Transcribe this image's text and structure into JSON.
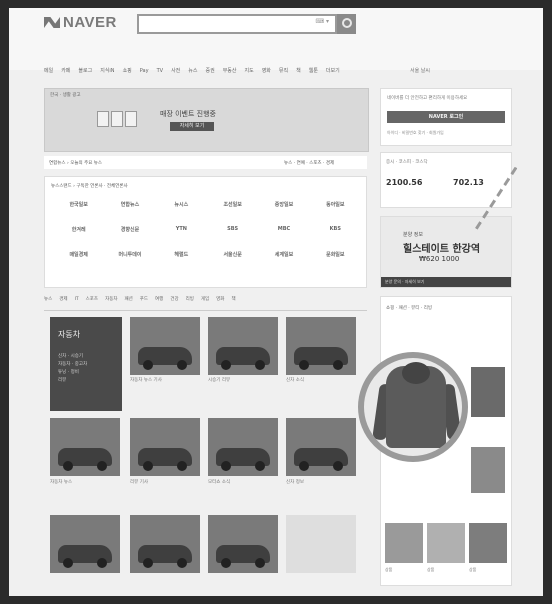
{
  "header": {
    "logo": "NAVER"
  },
  "main": {
    "topic_title": "자동차"
  },
  "sidebar": {
    "login_button": "NAVER 로그인",
    "stock_a": "2100.56",
    "stock_b": "702.13",
    "ad_title": "힐스테이트 한강역",
    "ad_price": "₩620 1000"
  },
  "colors": {
    "circle_outline": "#9a9a9a",
    "background": "#2b2b2b"
  }
}
